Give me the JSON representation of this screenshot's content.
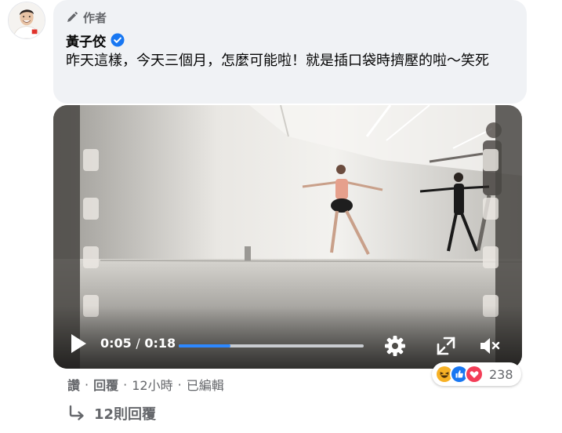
{
  "comment": {
    "author_badge": "作者",
    "author_name": "黃子佼",
    "verified": true,
    "text": "昨天這樣，今天三個月，怎麼可能啦！就是插口袋時擠壓的啦～笑死",
    "avatar_icon": "person-avatar-icon"
  },
  "video": {
    "current_time": "0:05",
    "separator": "/",
    "duration": "0:18",
    "progress_fraction": 0.28,
    "progress_color": "#2d88ff",
    "icons": [
      "play-icon",
      "settings-gear-icon",
      "fullscreen-expand-icon",
      "volume-muted-icon"
    ]
  },
  "actions": {
    "like_label": "讚",
    "reply_label": "回覆",
    "timestamp": "12小時",
    "edited_label": "已編輯",
    "separator": "·"
  },
  "reactions": {
    "types": [
      "haha",
      "like",
      "love"
    ],
    "count": "238"
  },
  "replies": {
    "label": "12則回覆",
    "icon": "reply-arrow-icon"
  }
}
